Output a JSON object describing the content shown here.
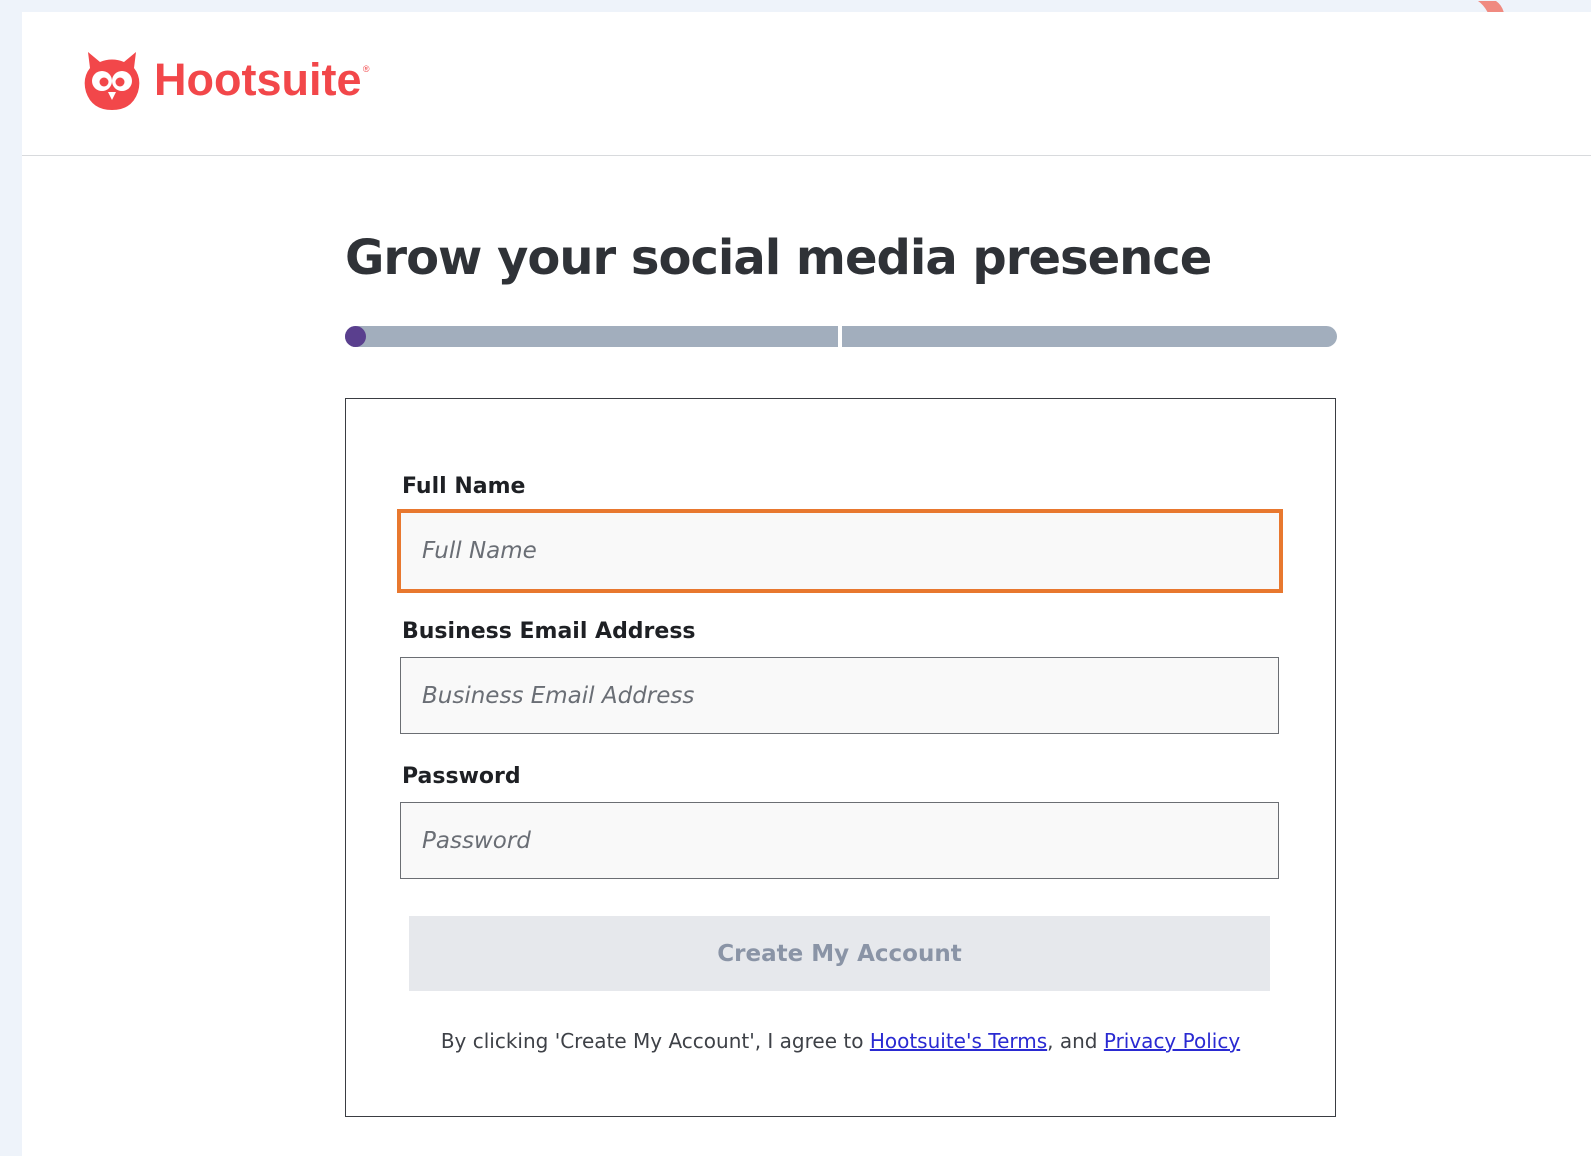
{
  "header": {
    "logo_text": "Hootsuite",
    "logo_reg": "®"
  },
  "main": {
    "title": "Grow your social media presence",
    "progress": {
      "steps": 2,
      "current_step": 1
    }
  },
  "form": {
    "full_name": {
      "label": "Full Name",
      "placeholder": "Full Name",
      "value": ""
    },
    "email": {
      "label": "Business Email Address",
      "placeholder": "Business Email Address",
      "value": ""
    },
    "password": {
      "label": "Password",
      "placeholder": "Password",
      "value": ""
    },
    "submit_label": "Create My Account",
    "legal": {
      "prefix": "By clicking 'Create My Account', I agree to ",
      "terms_link": "Hootsuite's Terms",
      "middle": ", and ",
      "privacy_link": "Privacy Policy"
    }
  },
  "colors": {
    "brand": "#f2474a",
    "focus_border": "#e8782f",
    "progress_active": "#5a3f8e",
    "progress_track": "#a2aebd",
    "link": "#2a2ad2"
  }
}
